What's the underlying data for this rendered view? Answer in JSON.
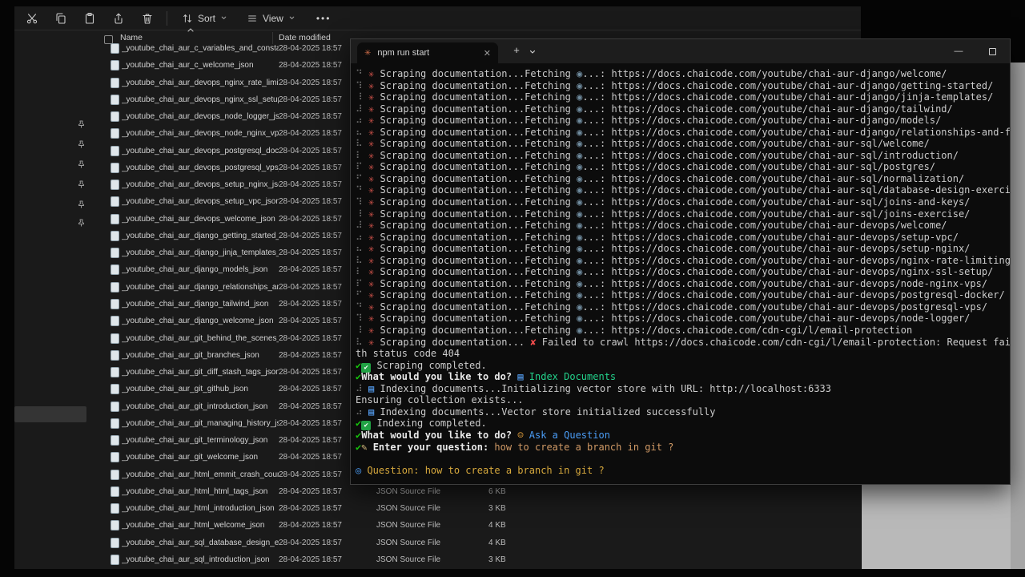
{
  "explorer": {
    "toolbar": {
      "buttons": [
        "cut",
        "copy",
        "paste",
        "share",
        "delete"
      ],
      "sort": "Sort",
      "view": "View",
      "more": "•••"
    },
    "header": {
      "name": "Name",
      "date": "Date modified"
    },
    "date_modified": "28-04-2025 18:57",
    "files": [
      "_youtube_chai_aur_c_variables_and_constant...",
      "_youtube_chai_aur_c_welcome_json",
      "_youtube_chai_aur_devops_nginx_rate_limiti...",
      "_youtube_chai_aur_devops_nginx_ssl_setup_...",
      "_youtube_chai_aur_devops_node_logger_json",
      "_youtube_chai_aur_devops_node_nginx_vps_...",
      "_youtube_chai_aur_devops_postgresql_dock...",
      "_youtube_chai_aur_devops_postgresql_vps_j...",
      "_youtube_chai_aur_devops_setup_nginx_json",
      "_youtube_chai_aur_devops_setup_vpc_json",
      "_youtube_chai_aur_devops_welcome_json",
      "_youtube_chai_aur_django_getting_started_j...",
      "_youtube_chai_aur_django_jinja_templates_j...",
      "_youtube_chai_aur_django_models_json",
      "_youtube_chai_aur_django_relationships_an...",
      "_youtube_chai_aur_django_tailwind_json",
      "_youtube_chai_aur_django_welcome_json",
      "_youtube_chai_aur_git_behind_the_scenes_j...",
      "_youtube_chai_aur_git_branches_json",
      "_youtube_chai_aur_git_diff_stash_tags_json",
      "_youtube_chai_aur_git_github_json",
      "_youtube_chai_aur_git_introduction_json",
      "_youtube_chai_aur_git_managing_history_js...",
      "_youtube_chai_aur_git_terminology_json",
      "_youtube_chai_aur_git_welcome_json",
      "_youtube_chai_aur_html_emmit_crash_cours...",
      "_youtube_chai_aur_html_html_tags_json",
      "_youtube_chai_aur_html_introduction_json",
      "_youtube_chai_aur_html_welcome_json",
      "_youtube_chai_aur_sql_database_design_exer...",
      "_youtube_chai_aur_sql_introduction_json"
    ],
    "details": {
      "start_index": 26,
      "type_label": "JSON Source File",
      "sizes": [
        "6 KB",
        "3 KB",
        "4 KB",
        "4 KB",
        "3 KB"
      ]
    },
    "sidebar": {
      "pin_count": 6
    }
  },
  "terminal": {
    "tab_title": "npm run start",
    "icons": {
      "tab_glyph": "✳",
      "close_tab": "✕",
      "new_tab": "+",
      "minimize": "—"
    },
    "scrape": {
      "spider": "✳",
      "label": "Scraping documentation...",
      "fetching": "Fetching",
      "globe": "◉",
      "sep": "...: "
    },
    "lines": [
      {
        "kind": "scrape",
        "spin": "⠙",
        "url": "https://docs.chaicode.com/youtube/chai-aur-django/welcome/"
      },
      {
        "kind": "scrape",
        "spin": "⠹",
        "url": "https://docs.chaicode.com/youtube/chai-aur-django/getting-started/"
      },
      {
        "kind": "scrape",
        "spin": "⠸",
        "url": "https://docs.chaicode.com/youtube/chai-aur-django/jinja-templates/"
      },
      {
        "kind": "scrape",
        "spin": "⠼",
        "url": "https://docs.chaicode.com/youtube/chai-aur-django/tailwind/"
      },
      {
        "kind": "scrape",
        "spin": "⠴",
        "url": "https://docs.chaicode.com/youtube/chai-aur-django/models/"
      },
      {
        "kind": "scrape",
        "spin": "⠦",
        "url": "https://docs.chaicode.com/youtube/chai-aur-django/relationships-and-forms/"
      },
      {
        "kind": "scrape",
        "spin": "⠧",
        "url": "https://docs.chaicode.com/youtube/chai-aur-sql/welcome/"
      },
      {
        "kind": "scrape",
        "spin": "⠇",
        "url": "https://docs.chaicode.com/youtube/chai-aur-sql/introduction/"
      },
      {
        "kind": "scrape",
        "spin": "⠏",
        "url": "https://docs.chaicode.com/youtube/chai-aur-sql/postgres/"
      },
      {
        "kind": "scrape",
        "spin": "⠋",
        "url": "https://docs.chaicode.com/youtube/chai-aur-sql/normalization/"
      },
      {
        "kind": "scrape",
        "spin": "⠙",
        "url": "https://docs.chaicode.com/youtube/chai-aur-sql/database-design-exercise/"
      },
      {
        "kind": "scrape",
        "spin": "⠹",
        "url": "https://docs.chaicode.com/youtube/chai-aur-sql/joins-and-keys/"
      },
      {
        "kind": "scrape",
        "spin": "⠸",
        "url": "https://docs.chaicode.com/youtube/chai-aur-sql/joins-exercise/"
      },
      {
        "kind": "scrape",
        "spin": "⠼",
        "url": "https://docs.chaicode.com/youtube/chai-aur-devops/welcome/"
      },
      {
        "kind": "scrape",
        "spin": "⠴",
        "url": "https://docs.chaicode.com/youtube/chai-aur-devops/setup-vpc/"
      },
      {
        "kind": "scrape",
        "spin": "⠦",
        "url": "https://docs.chaicode.com/youtube/chai-aur-devops/setup-nginx/"
      },
      {
        "kind": "scrape",
        "spin": "⠧",
        "url": "https://docs.chaicode.com/youtube/chai-aur-devops/nginx-rate-limiting/"
      },
      {
        "kind": "scrape",
        "spin": "⠇",
        "url": "https://docs.chaicode.com/youtube/chai-aur-devops/nginx-ssl-setup/"
      },
      {
        "kind": "scrape",
        "spin": "⠏",
        "url": "https://docs.chaicode.com/youtube/chai-aur-devops/node-nginx-vps/"
      },
      {
        "kind": "scrape",
        "spin": "⠋",
        "url": "https://docs.chaicode.com/youtube/chai-aur-devops/postgresql-docker/"
      },
      {
        "kind": "scrape",
        "spin": "⠙",
        "url": "https://docs.chaicode.com/youtube/chai-aur-devops/postgresql-vps/"
      },
      {
        "kind": "scrape",
        "spin": "⠹",
        "url": "https://docs.chaicode.com/youtube/chai-aur-devops/node-logger/"
      },
      {
        "kind": "scrape",
        "spin": "⠸",
        "url": "https://docs.chaicode.com/cdn-cgi/l/email-protection"
      },
      {
        "kind": "seg",
        "parts": [
          {
            "t": "⠧ ",
            "c": "dim",
            "n": "spinner"
          },
          {
            "t": "✳",
            "c": "spider",
            "n": "spider-icon"
          },
          {
            "t": " Scraping documentation... ",
            "c": "fg"
          },
          {
            "t": "✘",
            "c": "red",
            "n": "error-cross-icon"
          },
          {
            "t": " Failed to crawl https://docs.chaicode.com/cdn-cgi/l/email-protection: Request failed wi",
            "c": "fg"
          }
        ]
      },
      {
        "kind": "seg",
        "parts": [
          {
            "t": "th status code 404",
            "c": "fg"
          }
        ]
      },
      {
        "kind": "seg",
        "parts": [
          {
            "t": "✔",
            "c": "grn",
            "n": "check-icon"
          },
          {
            "t": "✔",
            "c": "badge",
            "n": "success-badge-icon"
          },
          {
            "t": " Scraping completed.",
            "c": "fg"
          }
        ]
      },
      {
        "kind": "seg",
        "parts": [
          {
            "t": "✔",
            "c": "grn",
            "n": "check-icon"
          },
          {
            "t": "What would you like to do? ",
            "c": "fgb"
          },
          {
            "t": "▤",
            "c": "index",
            "n": "card-index-icon"
          },
          {
            "t": " Index Documents",
            "c": "bgrn"
          }
        ]
      },
      {
        "kind": "seg",
        "parts": [
          {
            "t": "⠼ ",
            "c": "dim",
            "n": "spinner"
          },
          {
            "t": "▤",
            "c": "index",
            "n": "card-index-icon"
          },
          {
            "t": " Indexing documents...Initializing vector store with URL: http://localhost:6333",
            "c": "fg"
          }
        ]
      },
      {
        "kind": "seg",
        "parts": [
          {
            "t": "Ensuring collection exists...",
            "c": "fg"
          }
        ]
      },
      {
        "kind": "seg",
        "parts": [
          {
            "t": "⠴ ",
            "c": "dim",
            "n": "spinner"
          },
          {
            "t": "▤",
            "c": "index",
            "n": "card-index-icon"
          },
          {
            "t": " Indexing documents...Vector store initialized successfully",
            "c": "fg"
          }
        ]
      },
      {
        "kind": "seg",
        "parts": [
          {
            "t": "✔",
            "c": "grn",
            "n": "check-icon"
          },
          {
            "t": "✔",
            "c": "badge",
            "n": "success-badge-icon"
          },
          {
            "t": " Indexing completed.",
            "c": "fg"
          }
        ]
      },
      {
        "kind": "seg",
        "parts": [
          {
            "t": "✔",
            "c": "grn",
            "n": "check-icon"
          },
          {
            "t": "What would you like to do? ",
            "c": "fgb"
          },
          {
            "t": "☺",
            "c": "raise",
            "n": "person-raising-hand-icon"
          },
          {
            "t": " Ask a Question",
            "c": "blu"
          }
        ]
      },
      {
        "kind": "seg",
        "parts": [
          {
            "t": "✔",
            "c": "grn",
            "n": "check-icon"
          },
          {
            "t": "✎",
            "c": "memo",
            "n": "memo-icon"
          },
          {
            "t": " Enter your question: ",
            "c": "fgb"
          },
          {
            "t": "how to create a branch in git ?",
            "c": "orn"
          }
        ]
      },
      {
        "kind": "seg",
        "parts": []
      },
      {
        "kind": "seg",
        "parts": [
          {
            "t": "◎ ",
            "c": "blu",
            "n": "magnifier-icon"
          },
          {
            "t": "Question: how to create a branch in git ?",
            "c": "yel"
          }
        ]
      }
    ]
  },
  "colors": {
    "terminal_bg": "#0c0c0c",
    "success_green": "#16c60c",
    "answer_green": "#23d18b",
    "link_blue": "#4a9cf5",
    "warn_yellow": "#d7a93d",
    "error_red": "#f14c4c"
  }
}
